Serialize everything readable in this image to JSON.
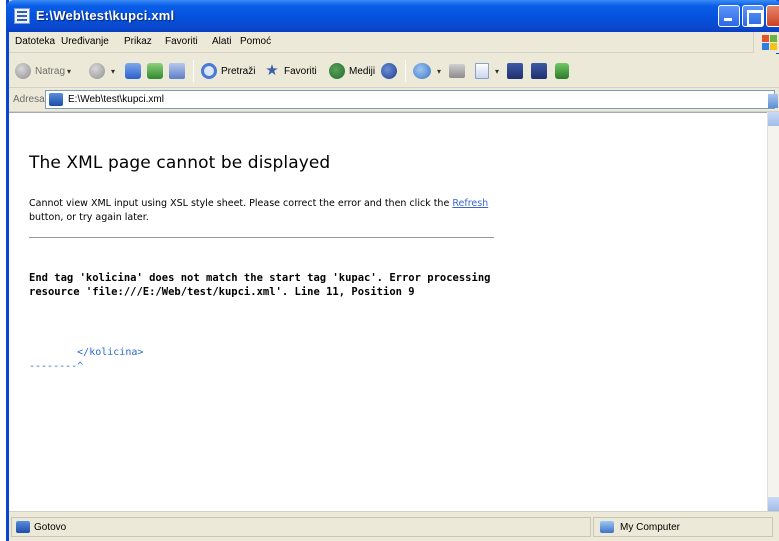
{
  "window": {
    "title": "E:\\Web\\test\\kupci.xml"
  },
  "menu": {
    "items": [
      "Datoteka",
      "Uređivanje",
      "Prikaz",
      "Favoriti",
      "Alati",
      "Pomoć"
    ]
  },
  "toolbar": {
    "back_label": "Natrag",
    "search_label": "Pretraži",
    "favorites_label": "Favoriti",
    "media_label": "Mediji"
  },
  "address": {
    "label": "Adresa",
    "url": "E:\\Web\\test\\kupci.xml"
  },
  "page": {
    "heading": "The XML page cannot be displayed",
    "message_part1": "Cannot view XML input using XSL style sheet. Please correct the error and then click the ",
    "refresh_link": "Refresh",
    "message_part2": " button, or try again later.",
    "error_text": "End tag 'kolicina' does not match the start tag 'kupac'. Error processing resource 'file:///E:/Web/test/kupci.xml'. Line 11, Position 9",
    "source_line": "        </kolicina>",
    "source_caret": "--------^"
  },
  "status": {
    "left_text": "Gotovo",
    "zone_text": "My Computer"
  }
}
